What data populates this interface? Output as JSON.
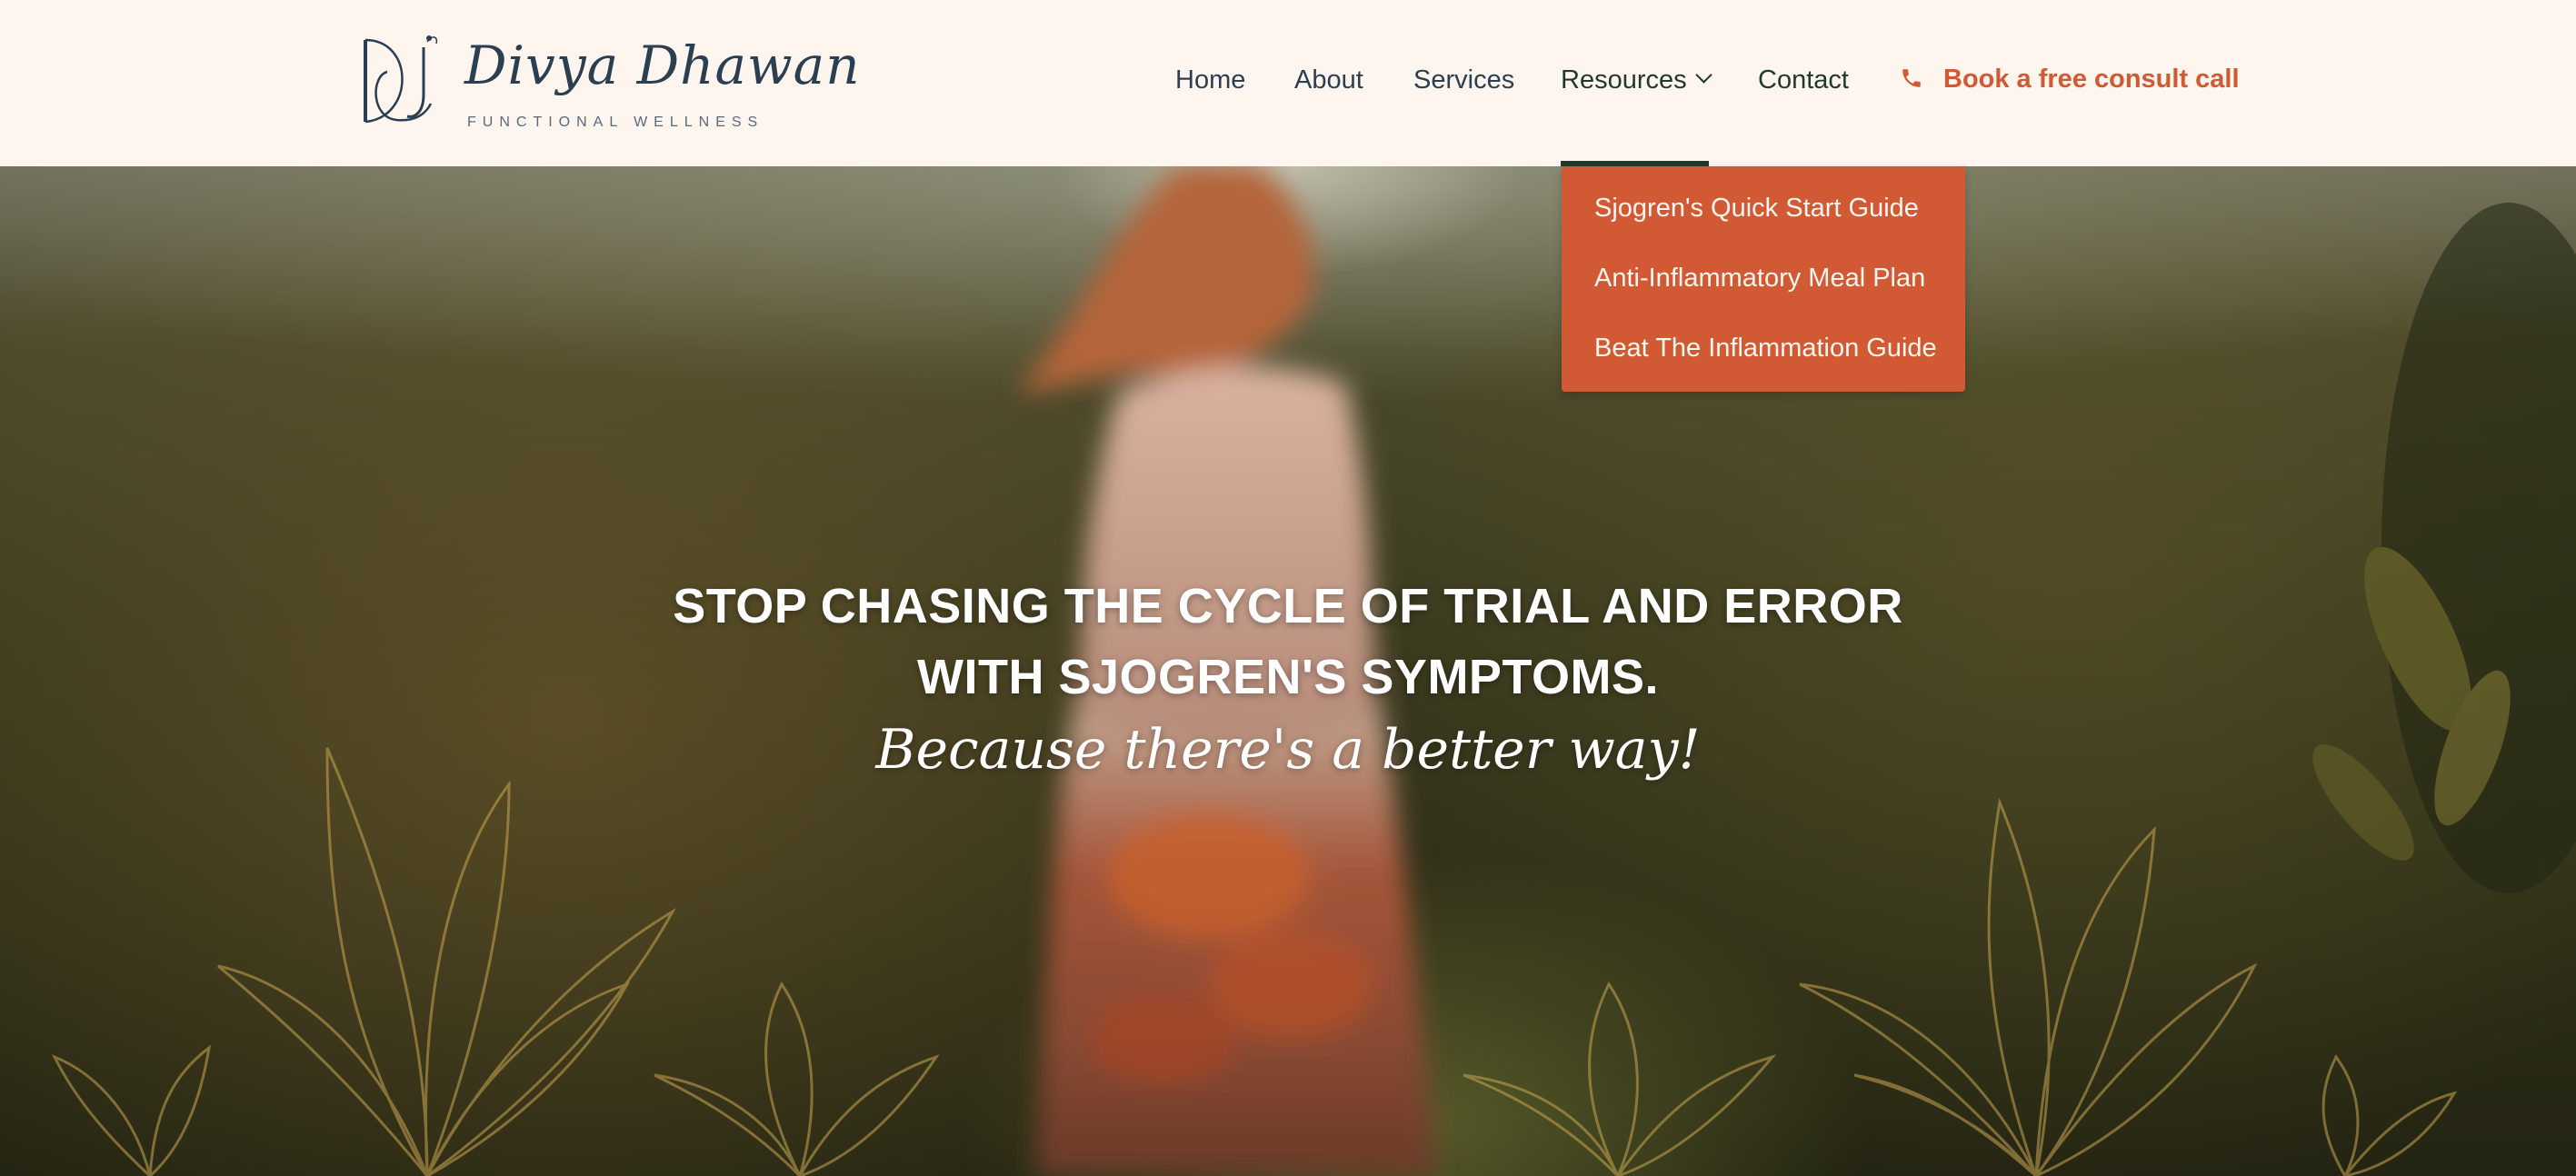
{
  "brand": {
    "name": "Divya Dhawan",
    "tagline": "FUNCTIONAL WELLNESS",
    "mark_icon": "dd-monogram-icon"
  },
  "nav": {
    "items": [
      {
        "label": "Home"
      },
      {
        "label": "About"
      },
      {
        "label": "Services"
      },
      {
        "label": "Resources",
        "has_dropdown": true,
        "active": true
      },
      {
        "label": "Contact"
      }
    ],
    "cta": {
      "label": "Book a free consult call",
      "icon": "phone-icon"
    }
  },
  "dropdown": {
    "items": [
      {
        "label": "Sjogren's Quick Start Guide"
      },
      {
        "label": "Anti-Inflammatory Meal Plan"
      },
      {
        "label": "Beat The Inflammation Guide"
      }
    ]
  },
  "hero": {
    "headline_line1": "STOP CHASING THE CYCLE OF TRIAL AND ERROR",
    "headline_line2": "WITH SJOGREN'S SYMPTOMS.",
    "subline": "Because there's a better way!"
  },
  "colors": {
    "header_bg": "#fdf5ee",
    "navy": "#2b3f52",
    "forest": "#1f3a2a",
    "accent": "#cf5a33",
    "dropdown_bg": "#d15a35"
  }
}
